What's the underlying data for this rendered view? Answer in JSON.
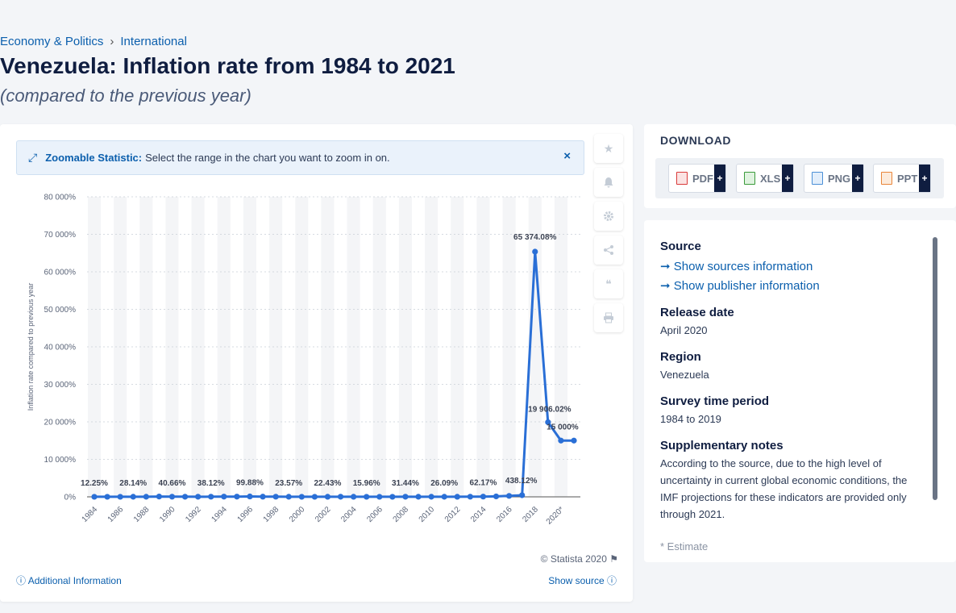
{
  "breadcrumb": {
    "items": [
      "Economy & Politics",
      "International"
    ],
    "separator": "›"
  },
  "page": {
    "title": "Venezuela: Inflation rate from 1984 to 2021",
    "subtitle": "(compared to the previous year)"
  },
  "zoom": {
    "label": "Zoomable Statistic:",
    "text": "Select the range in the chart you want to zoom in on.",
    "close": "×"
  },
  "tools": [
    "star-icon",
    "bell-icon",
    "gear-icon",
    "share-icon",
    "quote-icon",
    "print-icon"
  ],
  "chart_footer": {
    "copyright": "© Statista 2020",
    "additional": "Additional Information",
    "show_source": "Show source"
  },
  "download": {
    "title": "DOWNLOAD",
    "buttons": [
      {
        "label": "PDF",
        "color": "#d93a3a"
      },
      {
        "label": "XLS",
        "color": "#3a9a3a"
      },
      {
        "label": "PNG",
        "color": "#4a8fd6"
      },
      {
        "label": "PPT",
        "color": "#e8853a"
      }
    ],
    "plus": "+"
  },
  "info": {
    "source_head": "Source",
    "show_sources": "Show sources information",
    "show_publisher": "Show publisher information",
    "release_head": "Release date",
    "release_val": "April 2020",
    "region_head": "Region",
    "region_val": "Venezuela",
    "survey_head": "Survey time period",
    "survey_val": "1984 to 2019",
    "notes_head": "Supplementary notes",
    "notes_val": "According to the source, due to the high level of uncertainty in current global economic conditions, the IMF projections for these indicators are provided only through 2021.",
    "estimate": "* Estimate"
  },
  "colors": {
    "line": "#2a6fd6",
    "accent": "#0b5fad",
    "navy": "#0f1d40"
  },
  "chart_data": {
    "type": "line",
    "title": "",
    "xlabel": "",
    "ylabel": "Inflation rate compared to previous year",
    "ylim": [
      0,
      80000
    ],
    "yticks": [
      0,
      10000,
      20000,
      30000,
      40000,
      50000,
      60000,
      70000,
      80000
    ],
    "ytick_labels": [
      "0%",
      "10 000%",
      "20 000%",
      "30 000%",
      "40 000%",
      "50 000%",
      "60 000%",
      "70 000%",
      "80 000%"
    ],
    "x": [
      1984,
      1985,
      1986,
      1987,
      1988,
      1989,
      1990,
      1991,
      1992,
      1993,
      1994,
      1995,
      1996,
      1997,
      1998,
      1999,
      2000,
      2001,
      2002,
      2003,
      2004,
      2005,
      2006,
      2007,
      2008,
      2009,
      2010,
      2011,
      2012,
      2013,
      2014,
      2015,
      2016,
      2017,
      2018,
      2019,
      2020,
      2021
    ],
    "xtick_labels": [
      "1984",
      "1986",
      "1988",
      "1990",
      "1992",
      "1994",
      "1996",
      "1998",
      "2000",
      "2002",
      "2004",
      "2006",
      "2008",
      "2010",
      "2012",
      "2014",
      "2016",
      "2018",
      "2020*"
    ],
    "series": [
      {
        "values": [
          12.25,
          11.4,
          11.5,
          28.14,
          29.5,
          84.5,
          40.66,
          34.2,
          31.4,
          38.12,
          60.8,
          59.9,
          99.88,
          50.0,
          35.8,
          23.57,
          16.2,
          12.5,
          22.43,
          31.1,
          21.7,
          15.96,
          13.7,
          18.7,
          31.44,
          27.1,
          28.2,
          26.09,
          21.1,
          40.6,
          62.17,
          121.7,
          254.9,
          438.12,
          65374.08,
          19906.02,
          15000,
          15000
        ],
        "data_labels": [
          {
            "index": 0,
            "text": "12.25%"
          },
          {
            "index": 3,
            "text": "28.14%"
          },
          {
            "index": 6,
            "text": "40.66%"
          },
          {
            "index": 9,
            "text": "38.12%"
          },
          {
            "index": 12,
            "text": "99.88%"
          },
          {
            "index": 15,
            "text": "23.57%"
          },
          {
            "index": 18,
            "text": "22.43%"
          },
          {
            "index": 21,
            "text": "15.96%"
          },
          {
            "index": 24,
            "text": "31.44%"
          },
          {
            "index": 27,
            "text": "26.09%"
          },
          {
            "index": 30,
            "text": "62.17%"
          },
          {
            "index": 33,
            "text": "438.12%"
          },
          {
            "index": 34,
            "text": "65 374.08%"
          },
          {
            "index": 35,
            "text": "19 906.02%"
          },
          {
            "index": 36,
            "text": "15 000%"
          }
        ]
      }
    ],
    "grid": true,
    "alternating_bands": true
  }
}
